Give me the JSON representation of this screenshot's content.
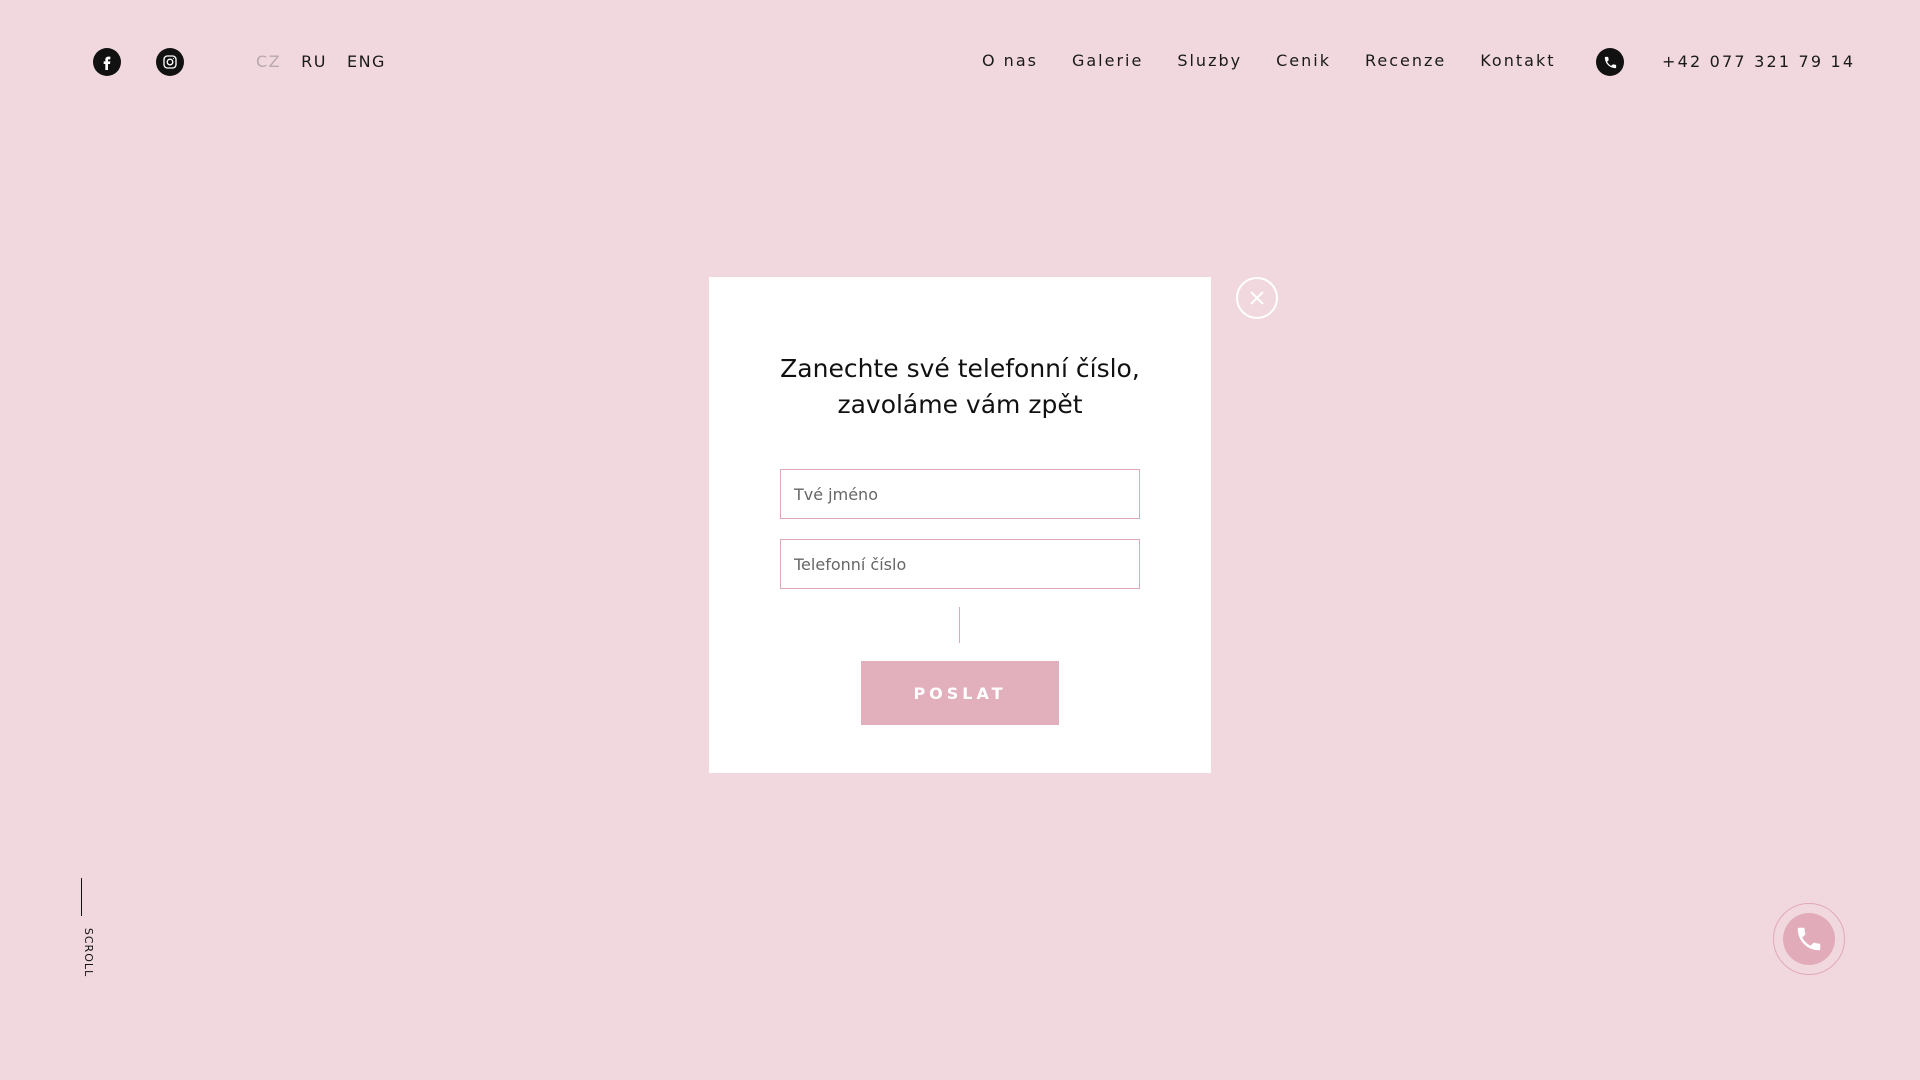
{
  "header": {
    "social": [
      {
        "icon": "facebook-icon"
      },
      {
        "icon": "instagram-icon"
      }
    ],
    "languages": [
      {
        "label": "CZ",
        "active": true
      },
      {
        "label": "RU",
        "active": false
      },
      {
        "label": "ENG",
        "active": false
      }
    ],
    "nav": [
      "O nas",
      "Galerie",
      "Sluzby",
      "Cenik",
      "Recenze",
      "Kontakt"
    ],
    "phone_icon": "phone-icon",
    "phone": "+42 077 321 79 14"
  },
  "scroll_label": "SCROLL",
  "modal": {
    "title_line1": "Zanechte své telefonní číslo,",
    "title_line2": "zavoláme vám zpět",
    "name_placeholder": "Tvé jméno",
    "phone_placeholder": "Telefonní číslo",
    "submit_label": "POSLAT",
    "close_icon": "close-icon"
  },
  "floating_call_icon": "phone-icon",
  "colors": {
    "background": "#f0d8de",
    "accent": "#e2b0bd",
    "field_border": "#e0a9b8",
    "modal_bg": "#ffffff",
    "text": "#111111"
  }
}
